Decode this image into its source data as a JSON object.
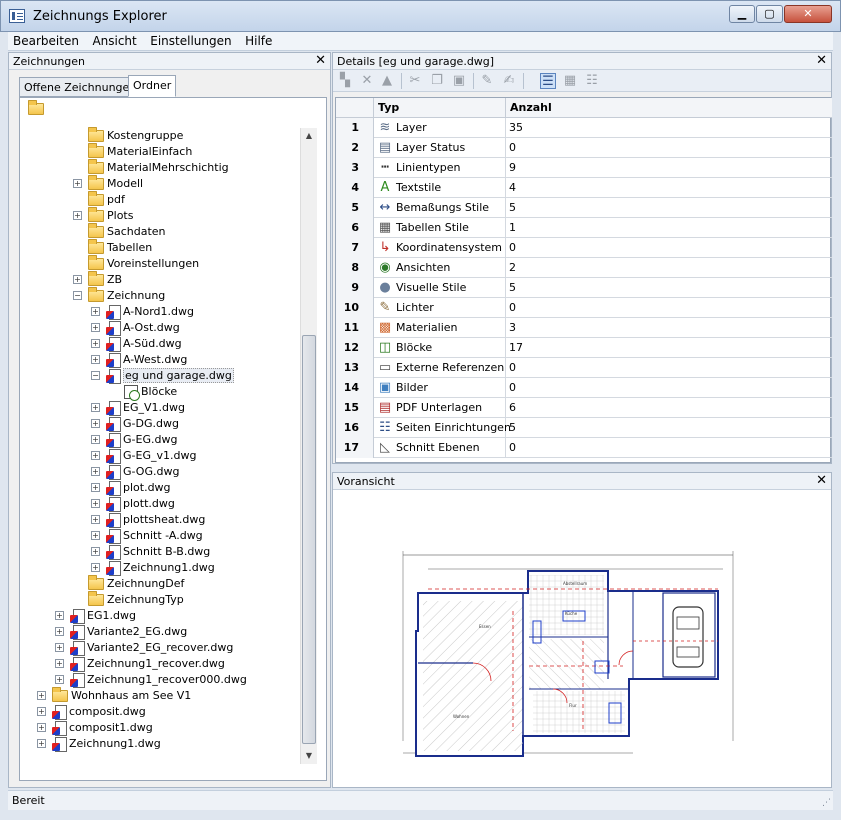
{
  "window": {
    "title": "Zeichnungs Explorer"
  },
  "menu": [
    "Bearbeiten",
    "Ansicht",
    "Einstellungen",
    "Hilfe"
  ],
  "left_panel": {
    "title": "Zeichnungen",
    "tabs": [
      "Offene Zeichnungen",
      "Ordner"
    ],
    "active_tab": "Ordner",
    "tree": [
      {
        "label": "Kostengruppe",
        "icon": "folder-icon",
        "indent": 3,
        "expander": ""
      },
      {
        "label": "MaterialEinfach",
        "icon": "folder-icon",
        "indent": 3,
        "expander": ""
      },
      {
        "label": "MaterialMehrschichtig",
        "icon": "folder-icon",
        "indent": 3,
        "expander": ""
      },
      {
        "label": "Modell",
        "icon": "folder-icon",
        "indent": 3,
        "expander": "+"
      },
      {
        "label": "pdf",
        "icon": "folder-icon",
        "indent": 3,
        "expander": ""
      },
      {
        "label": "Plots",
        "icon": "folder-icon",
        "indent": 3,
        "expander": "+"
      },
      {
        "label": "Sachdaten",
        "icon": "folder-icon",
        "indent": 3,
        "expander": ""
      },
      {
        "label": "Tabellen",
        "icon": "folder-icon",
        "indent": 3,
        "expander": ""
      },
      {
        "label": "Voreinstellungen",
        "icon": "folder-icon",
        "indent": 3,
        "expander": ""
      },
      {
        "label": "ZB",
        "icon": "folder-icon",
        "indent": 3,
        "expander": "+"
      },
      {
        "label": "Zeichnung",
        "icon": "folder-icon",
        "indent": 3,
        "expander": "-"
      },
      {
        "label": "A-Nord1.dwg",
        "icon": "dwg-icon",
        "indent": 4,
        "expander": "+"
      },
      {
        "label": "A-Ost.dwg",
        "icon": "dwg-icon",
        "indent": 4,
        "expander": "+"
      },
      {
        "label": "A-Süd.dwg",
        "icon": "dwg-icon",
        "indent": 4,
        "expander": "+"
      },
      {
        "label": "A-West.dwg",
        "icon": "dwg-icon",
        "indent": 4,
        "expander": "+"
      },
      {
        "label": "eg und garage.dwg",
        "icon": "dwg-icon",
        "indent": 4,
        "expander": "-",
        "selected": true
      },
      {
        "label": "Blöcke",
        "icon": "blocks-icon",
        "indent": 5,
        "expander": ""
      },
      {
        "label": "EG_V1.dwg",
        "icon": "dwg-icon",
        "indent": 4,
        "expander": "+"
      },
      {
        "label": "G-DG.dwg",
        "icon": "dwg-icon",
        "indent": 4,
        "expander": "+"
      },
      {
        "label": "G-EG.dwg",
        "icon": "dwg-icon",
        "indent": 4,
        "expander": "+"
      },
      {
        "label": "G-EG_v1.dwg",
        "icon": "dwg-icon",
        "indent": 4,
        "expander": "+"
      },
      {
        "label": "G-OG.dwg",
        "icon": "dwg-icon",
        "indent": 4,
        "expander": "+"
      },
      {
        "label": "plot.dwg",
        "icon": "dwg-icon",
        "indent": 4,
        "expander": "+"
      },
      {
        "label": "plott.dwg",
        "icon": "dwg-icon",
        "indent": 4,
        "expander": "+"
      },
      {
        "label": "plottsheat.dwg",
        "icon": "dwg-icon",
        "indent": 4,
        "expander": "+"
      },
      {
        "label": "Schnitt -A.dwg",
        "icon": "dwg-icon",
        "indent": 4,
        "expander": "+"
      },
      {
        "label": "Schnitt B-B.dwg",
        "icon": "dwg-icon",
        "indent": 4,
        "expander": "+"
      },
      {
        "label": "Zeichnung1.dwg",
        "icon": "dwg-icon",
        "indent": 4,
        "expander": "+"
      },
      {
        "label": "ZeichnungDef",
        "icon": "folder-icon",
        "indent": 3,
        "expander": ""
      },
      {
        "label": "ZeichnungTyp",
        "icon": "folder-icon",
        "indent": 3,
        "expander": ""
      },
      {
        "label": "EG1.dwg",
        "icon": "dwg-icon",
        "indent": 2,
        "expander": "+"
      },
      {
        "label": "Variante2_EG.dwg",
        "icon": "dwg-icon",
        "indent": 2,
        "expander": "+"
      },
      {
        "label": "Variante2_EG_recover.dwg",
        "icon": "dwg-icon",
        "indent": 2,
        "expander": "+"
      },
      {
        "label": "Zeichnung1_recover.dwg",
        "icon": "dwg-icon",
        "indent": 2,
        "expander": "+"
      },
      {
        "label": "Zeichnung1_recover000.dwg",
        "icon": "dwg-icon",
        "indent": 2,
        "expander": "+"
      },
      {
        "label": "Wohnhaus am See V1",
        "icon": "folder-icon",
        "indent": 1,
        "expander": "+"
      },
      {
        "label": "composit.dwg",
        "icon": "dwg-icon",
        "indent": 1,
        "expander": "+"
      },
      {
        "label": "composit1.dwg",
        "icon": "dwg-icon",
        "indent": 1,
        "expander": "+"
      },
      {
        "label": "Zeichnung1.dwg",
        "icon": "dwg-icon",
        "indent": 1,
        "expander": "+"
      }
    ]
  },
  "details_panel": {
    "title": "Details [eg und garage.dwg]",
    "columns": [
      "Typ",
      "Anzahl"
    ],
    "rows": [
      {
        "num": "1",
        "typ": "Layer",
        "anzahl": "35",
        "icon": "layers-icon",
        "glyph": "≋",
        "color": "#5a6c86"
      },
      {
        "num": "2",
        "typ": "Layer Status",
        "anzahl": "0",
        "icon": "layer-status-icon",
        "glyph": "▤",
        "color": "#5a6c86"
      },
      {
        "num": "3",
        "typ": "Linientypen",
        "anzahl": "9",
        "icon": "linetypes-icon",
        "glyph": "┅",
        "color": "#333333"
      },
      {
        "num": "4",
        "typ": "Textstile",
        "anzahl": "4",
        "icon": "textstyle-icon",
        "glyph": "A",
        "color": "#2e8b1e"
      },
      {
        "num": "5",
        "typ": "Bemaßungs Stile",
        "anzahl": "5",
        "icon": "dimstyle-icon",
        "glyph": "↔",
        "color": "#2d4d86"
      },
      {
        "num": "6",
        "typ": "Tabellen Stile",
        "anzahl": "1",
        "icon": "tablestyle-icon",
        "glyph": "▦",
        "color": "#555555"
      },
      {
        "num": "7",
        "typ": "Koordinatensystem",
        "anzahl": "0",
        "icon": "ucs-icon",
        "glyph": "↳",
        "color": "#c0302a"
      },
      {
        "num": "8",
        "typ": "Ansichten",
        "anzahl": "2",
        "icon": "eye-icon",
        "glyph": "◉",
        "color": "#2e7a2a"
      },
      {
        "num": "9",
        "typ": "Visuelle Stile",
        "anzahl": "5",
        "icon": "visualstyle-icon",
        "glyph": "●",
        "color": "#6a7f9b"
      },
      {
        "num": "10",
        "typ": "Lichter",
        "anzahl": "0",
        "icon": "light-icon",
        "glyph": "✎",
        "color": "#8c6d3d"
      },
      {
        "num": "11",
        "typ": "Materialien",
        "anzahl": "3",
        "icon": "material-icon",
        "glyph": "▩",
        "color": "#d06a32"
      },
      {
        "num": "12",
        "typ": "Blöcke",
        "anzahl": "17",
        "icon": "blocks-icon",
        "glyph": "◫",
        "color": "#2b7a1f"
      },
      {
        "num": "13",
        "typ": "Externe Referenzen",
        "anzahl": "0",
        "icon": "xref-icon",
        "glyph": "▭",
        "color": "#555555"
      },
      {
        "num": "14",
        "typ": "Bilder",
        "anzahl": "0",
        "icon": "image-icon",
        "glyph": "▣",
        "color": "#3f7fbf"
      },
      {
        "num": "15",
        "typ": "PDF Unterlagen",
        "anzahl": "6",
        "icon": "pdf-icon",
        "glyph": "▤",
        "color": "#b03030"
      },
      {
        "num": "16",
        "typ": "Seiten Einrichtungen",
        "anzahl": "5",
        "icon": "pagesetup-icon",
        "glyph": "☷",
        "color": "#2d4d86"
      },
      {
        "num": "17",
        "typ": "Schnitt Ebenen",
        "anzahl": "0",
        "icon": "section-icon",
        "glyph": "◺",
        "color": "#555555"
      }
    ]
  },
  "preview_panel": {
    "title": "Voransicht"
  },
  "status": {
    "text": "Bereit"
  },
  "colors": {
    "window_bg": "#dfe6ef",
    "close_button": "#c7523d",
    "selection": "#cde0f7"
  }
}
